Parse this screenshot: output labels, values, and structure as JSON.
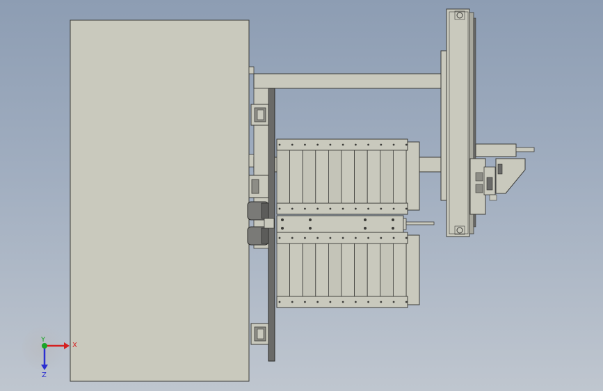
{
  "triad": {
    "x_label": "X",
    "y_label": "Y",
    "z_label": "Z",
    "x_color": "#d42020",
    "y_color": "#1aa526",
    "z_color": "#2b2ed1"
  },
  "colors": {
    "background_top": "#8d9db3",
    "background_bottom": "#bfc6cf",
    "part_fill": "#c9c9bd",
    "part_fill_dark": "#b6b6aa",
    "outline": "#3b3b38",
    "dark_part": "#6a6a68"
  }
}
